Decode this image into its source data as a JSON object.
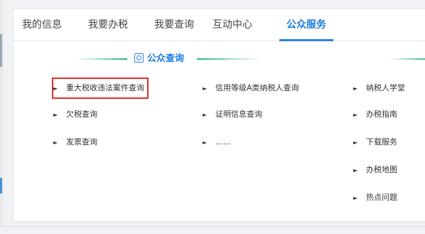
{
  "tabs": [
    {
      "label": "我的信息"
    },
    {
      "label": "我要办税"
    },
    {
      "label": "我要查询"
    },
    {
      "label": "互动中心"
    },
    {
      "label": "公众服务"
    }
  ],
  "active_tab": "公众服务",
  "section": {
    "title": "公众查询",
    "icon": "document-icon"
  },
  "columns": [
    {
      "items": [
        "重大税收违法案件查询",
        "欠税查询",
        "发票查询"
      ]
    },
    {
      "items": [
        "信用等级A类纳税人查询",
        "证明信息查询",
        "……"
      ]
    },
    {
      "items": [
        "纳税人学堂",
        "办税指南",
        "下载服务",
        "办税地图",
        "热点问题"
      ]
    }
  ],
  "highlighted_item": "重大税收违法案件查询",
  "colors": {
    "accent": "#1f7ddb",
    "divider_green": "#1fb279",
    "highlight_red": "#e22b2b"
  }
}
